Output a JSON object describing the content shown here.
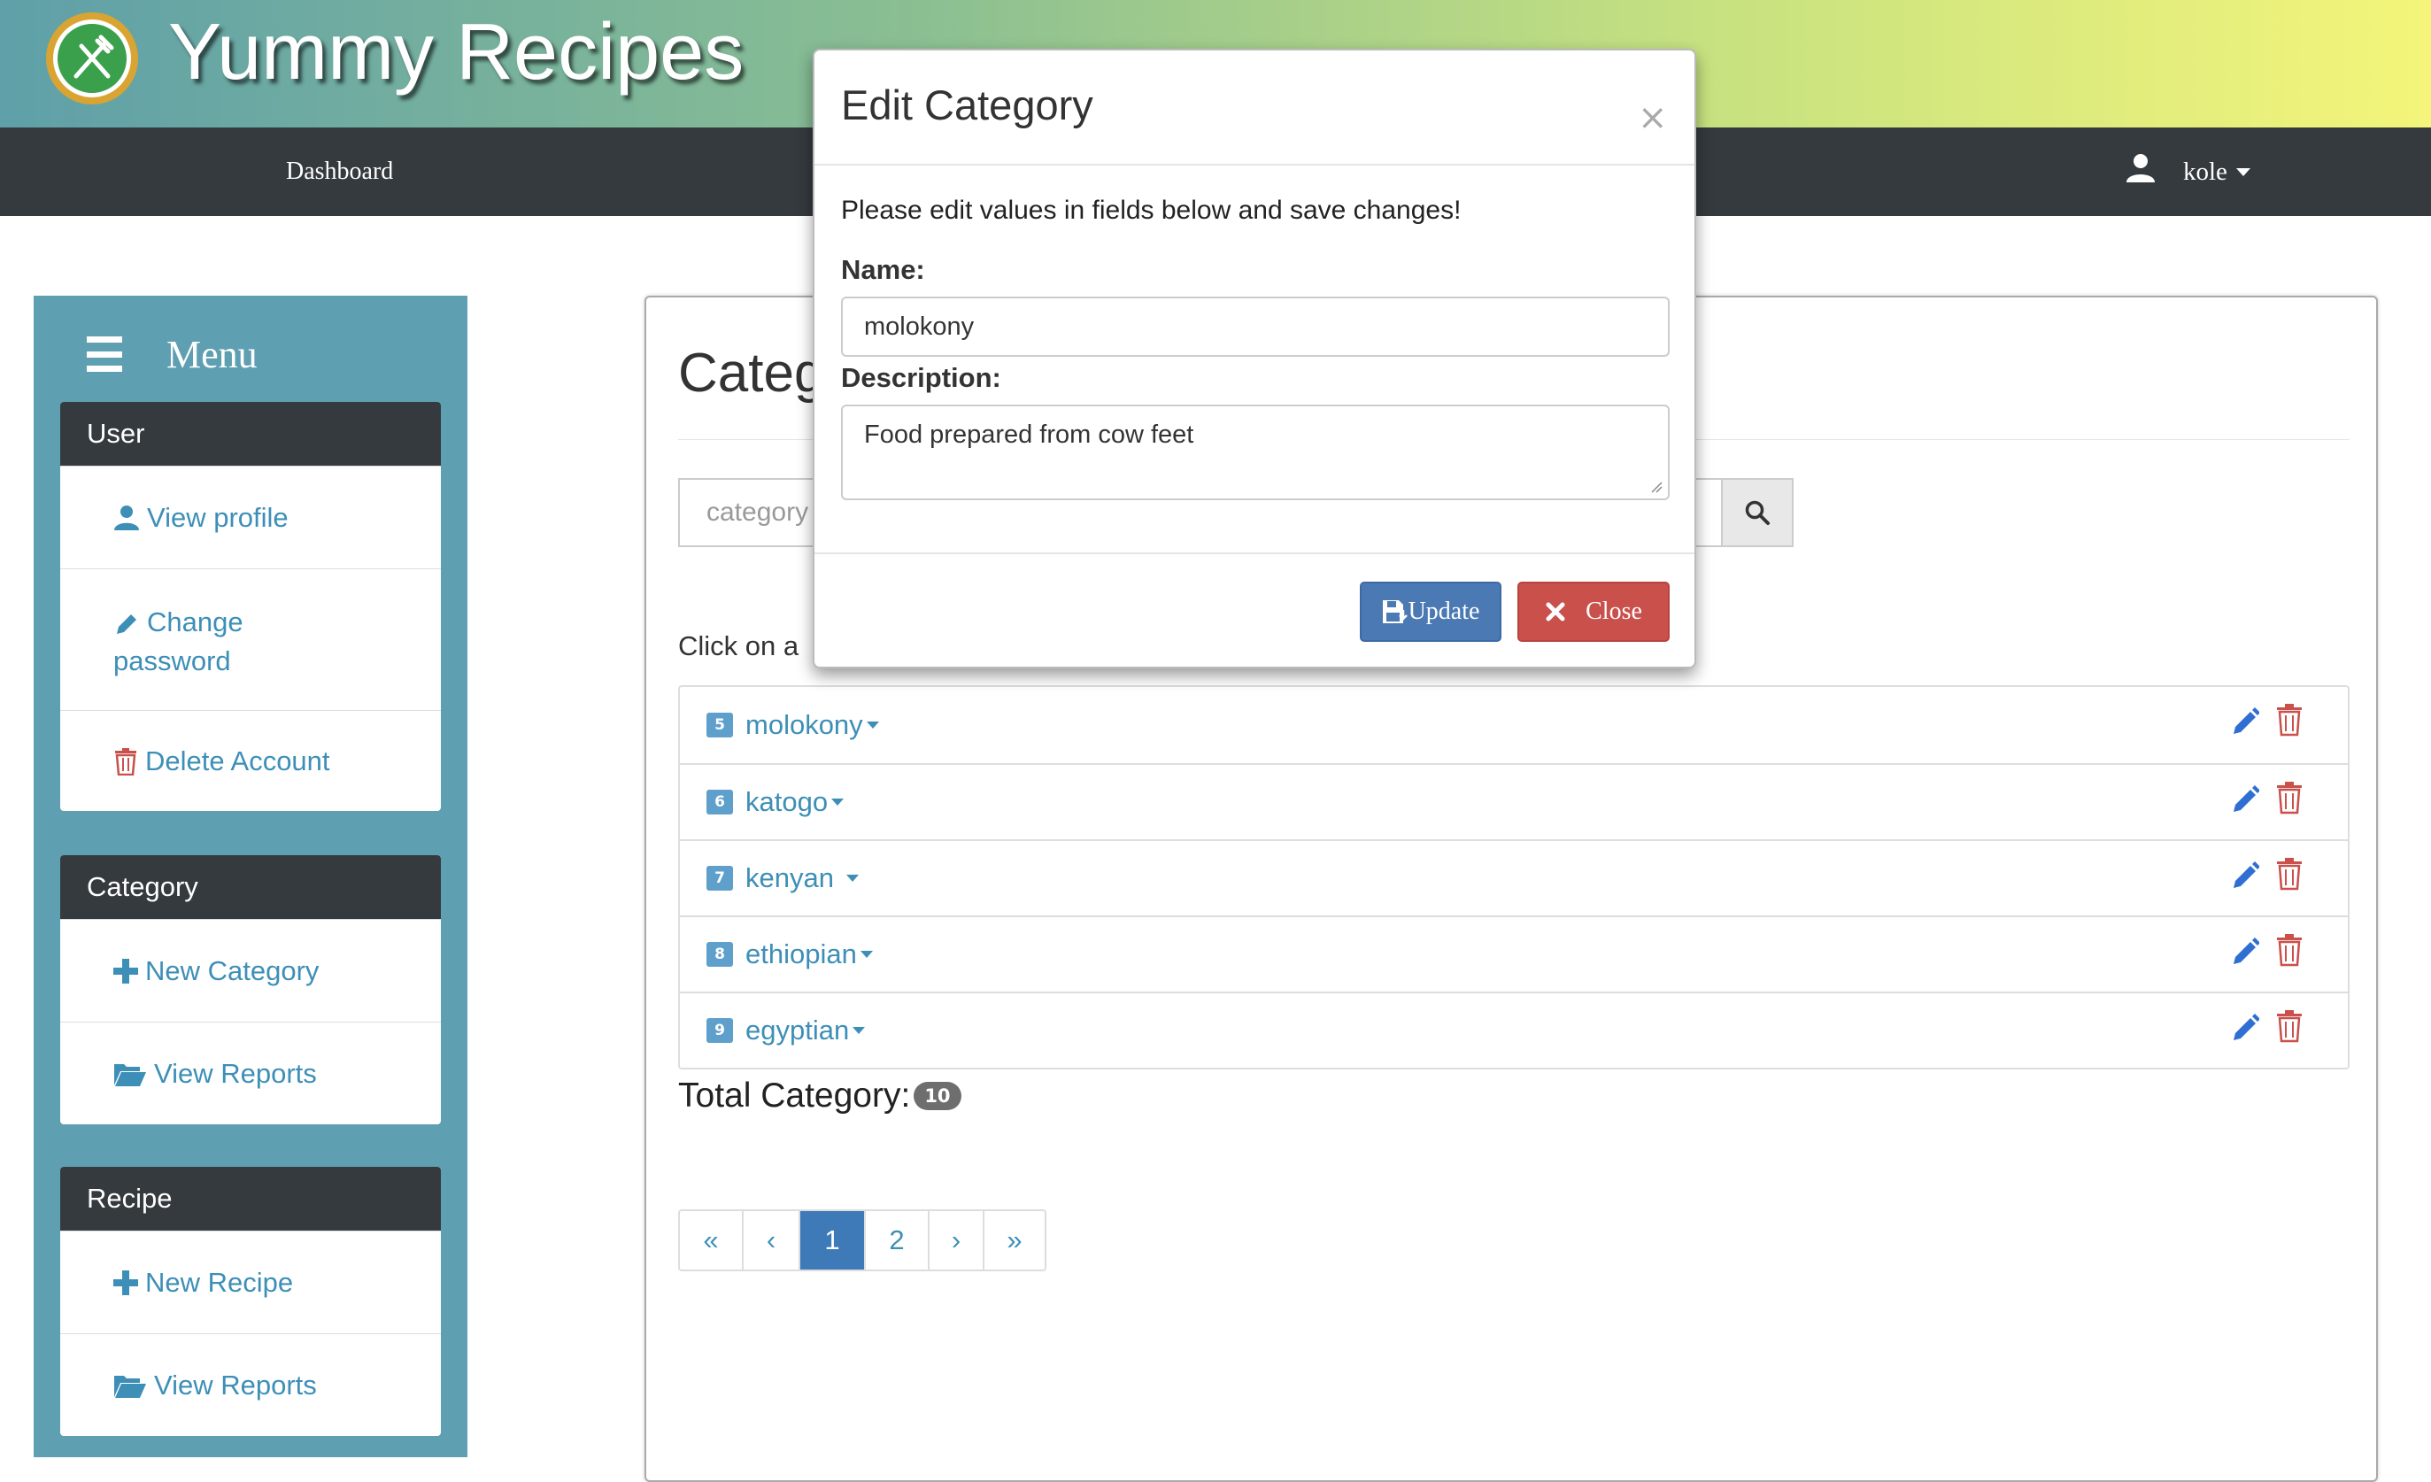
{
  "app": {
    "title": "Yummy Recipes",
    "logo_icon": "fork-knife-icon"
  },
  "navbar": {
    "dashboard_label": "Dashboard",
    "user_name": "kole"
  },
  "sidebar": {
    "menu_label": "Menu",
    "groups": [
      {
        "title": "User",
        "items": [
          {
            "label": "View profile",
            "icon": "user-icon"
          },
          {
            "label": "Change password",
            "icon": "pencil-icon"
          },
          {
            "label": "Delete Account",
            "icon": "trash-icon"
          }
        ]
      },
      {
        "title": "Category",
        "items": [
          {
            "label": "New Category",
            "icon": "plus-icon"
          },
          {
            "label": "View Reports",
            "icon": "folder-open-icon"
          }
        ]
      },
      {
        "title": "Recipe",
        "items": [
          {
            "label": "New Recipe",
            "icon": "plus-icon"
          },
          {
            "label": "View Reports",
            "icon": "folder-open-icon"
          }
        ]
      }
    ]
  },
  "main": {
    "title": "Categ",
    "search_placeholder": "category",
    "hint": "Click on a",
    "categories": [
      {
        "id": "5",
        "name": "molokony"
      },
      {
        "id": "6",
        "name": "katogo"
      },
      {
        "id": "7",
        "name": "kenyan"
      },
      {
        "id": "8",
        "name": "ethiopian"
      },
      {
        "id": "9",
        "name": "egyptian"
      }
    ],
    "total_label": "Total Category:",
    "total_count": "10",
    "pagination": [
      "«",
      "‹",
      "1",
      "2",
      "›",
      "»"
    ],
    "active_page": "1"
  },
  "modal": {
    "title": "Edit Category",
    "close_symbol": "×",
    "message": "Please edit values in fields below and save changes!",
    "name_label": "Name:",
    "name_value": "molokony",
    "description_label": "Description:",
    "description_value": "Food prepared from cow feet",
    "update_label": "Update",
    "close_label": "Close"
  },
  "colors": {
    "link": "#3d8fb7",
    "sidebar_bg": "#5e9fb1",
    "navbar_bg": "#353a3f",
    "primary": "#4a79b4",
    "danger": "#c9504b"
  }
}
